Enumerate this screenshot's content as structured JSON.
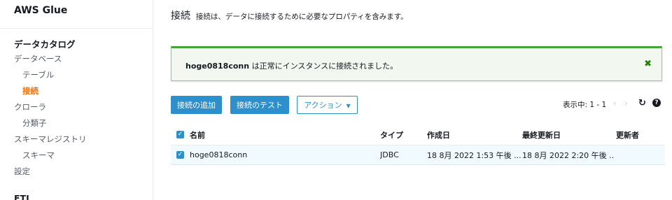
{
  "sidebar": {
    "brand": "AWS Glue",
    "section_title": "データカタログ",
    "items": [
      {
        "label": "データベース"
      },
      {
        "label": "テーブル"
      },
      {
        "label": "接続"
      },
      {
        "label": "クローラ"
      },
      {
        "label": "分類子"
      },
      {
        "label": "スキーマレジストリ"
      },
      {
        "label": "スキーマ"
      },
      {
        "label": "設定"
      }
    ],
    "etl_title": "ETL"
  },
  "page": {
    "title": "接続",
    "description": "接続は、データに接続するために必要なプロパティを含みます。"
  },
  "flash": {
    "name": "hoge0818conn",
    "message": " は正常にインスタンスに接続されました。",
    "close_glyph": "✖"
  },
  "toolbar": {
    "add_label": "接続の追加",
    "test_label": "接続のテスト",
    "action_label": "アクション",
    "action_caret": "▼"
  },
  "pager": {
    "text": "表示中: 1 - 1",
    "prev_glyph": "‹",
    "next_glyph": "›",
    "refresh_glyph": "↻",
    "help_glyph": "?"
  },
  "table": {
    "headers": {
      "name": "名前",
      "type": "タイプ",
      "created": "作成日",
      "updated": "最終更新日",
      "updated_by": "更新者"
    },
    "rows": [
      {
        "name": "hoge0818conn",
        "type": "JDBC",
        "created": "18 8月 2022 1:53 午後 ...",
        "updated": "18 8月 2022 2:20 午後 ...",
        "updated_by": ""
      }
    ],
    "check_glyph": "✓"
  },
  "colors": {
    "accent": "#2e8fcb",
    "active_nav": "#ec7211",
    "success": "#3fa535"
  }
}
